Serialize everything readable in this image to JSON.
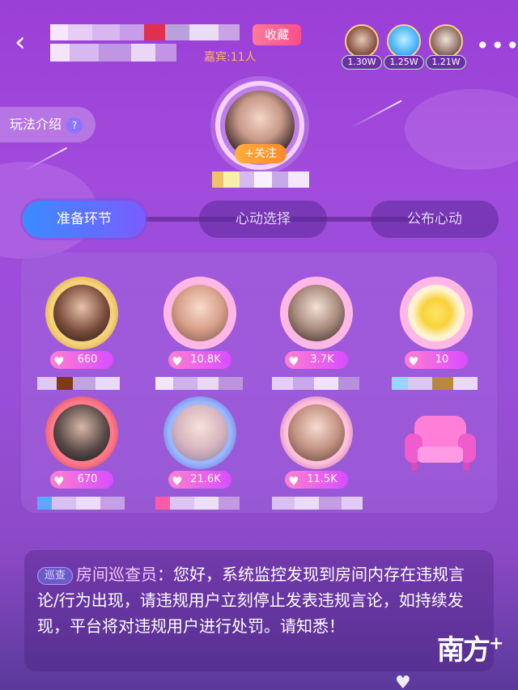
{
  "header": {
    "back_icon": "chevron-left-icon",
    "favorite_label": "收藏",
    "guest_count": "嘉宾:11人",
    "more_icon": "more-dots-icon",
    "top_contributors": [
      {
        "value": "1.30W"
      },
      {
        "value": "1.25W"
      },
      {
        "value": "1.21W"
      }
    ]
  },
  "intro_button": {
    "label": "玩法介绍",
    "icon": "question-icon"
  },
  "host": {
    "follow_label": "+关注"
  },
  "stages": [
    {
      "label": "准备环节",
      "active": true
    },
    {
      "label": "心动选择",
      "active": false
    },
    {
      "label": "公布心动",
      "active": false
    }
  ],
  "seats": [
    {
      "heart_value": "660",
      "frame_color": "#f0b43c"
    },
    {
      "heart_value": "10.8K",
      "frame_color": "#ff8fd8"
    },
    {
      "heart_value": "3.7K",
      "frame_color": "#ff8fd8"
    },
    {
      "heart_value": "10",
      "frame_color": "#ff8fd8"
    },
    {
      "heart_value": "670",
      "frame_color": "#e04a6a"
    },
    {
      "heart_value": "21.6K",
      "frame_color": "#7a5cff"
    },
    {
      "heart_value": "11.5K",
      "frame_color": "#b05cc8"
    },
    {
      "empty": true,
      "icon": "sofa-icon"
    }
  ],
  "notice": {
    "badge": "巡查",
    "sender": "房间巡查员",
    "message": "：您好，系统监控发现到房间内存在违规言论/行为出现，请违规用户立刻停止发表违规言论，如持续发现，平台将对违规用户进行处罚。请知悉！"
  },
  "watermark": {
    "text": "南方",
    "plus": "+"
  },
  "colors": {
    "background": "#9b3fd6",
    "accent_blue": "#3a8cff",
    "favorite": "#ff4d8d",
    "follow": "#ffae3b"
  }
}
